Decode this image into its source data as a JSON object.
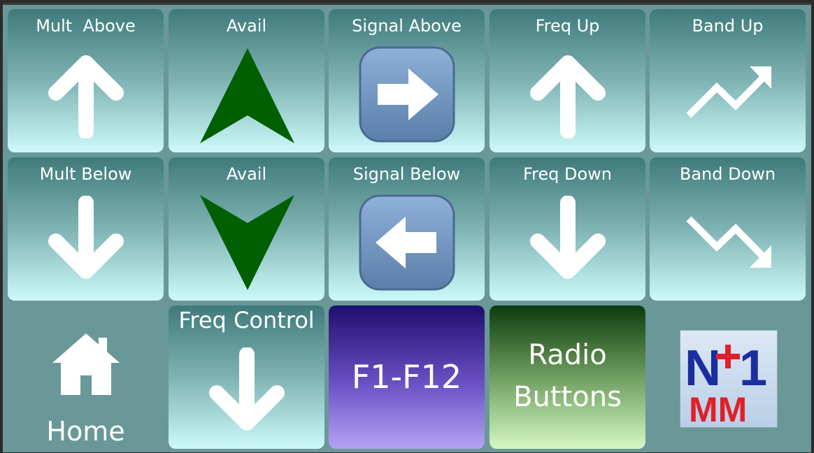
{
  "tiles": {
    "mult_above": "Mult  Above",
    "avail_up": "Avail",
    "signal_above": "Signal Above",
    "freq_up": "Freq Up",
    "band_up": "Band Up",
    "mult_below": "Mult Below",
    "avail_down": "Avail",
    "signal_below": "Signal Below",
    "freq_down": "Freq Down",
    "band_down": "Band Down",
    "freq_control": "Freq Control",
    "function_keys": "F1-F12",
    "radio_buttons_line1": "Radio",
    "radio_buttons_line2": "Buttons",
    "home": "Home"
  },
  "icons": {
    "mult_above": "arrow-up-icon",
    "avail_up": "triangle-up-icon",
    "signal_above": "arrow-right-emoji-icon",
    "freq_up": "arrow-up-icon",
    "band_up": "trending-up-icon",
    "mult_below": "arrow-down-icon",
    "avail_down": "triangle-down-icon",
    "signal_below": "arrow-left-emoji-icon",
    "freq_down": "arrow-down-icon",
    "band_down": "trending-down-icon",
    "freq_control": "arrow-down-icon",
    "home": "home-icon",
    "logo": "n1mm-logo"
  },
  "colors": {
    "background": "#6a9898",
    "tile_top": "#3f7a7a",
    "tile_bottom": "#ccfafa",
    "avail_arrow": "#005f00",
    "purple_top": "#1f0d6e",
    "purple_bottom": "#b3a3f4",
    "green_top": "#0d3a0d",
    "green_bottom": "#d4f8c2",
    "logo_blue": "#1a2ea0",
    "logo_red": "#e0202a"
  }
}
